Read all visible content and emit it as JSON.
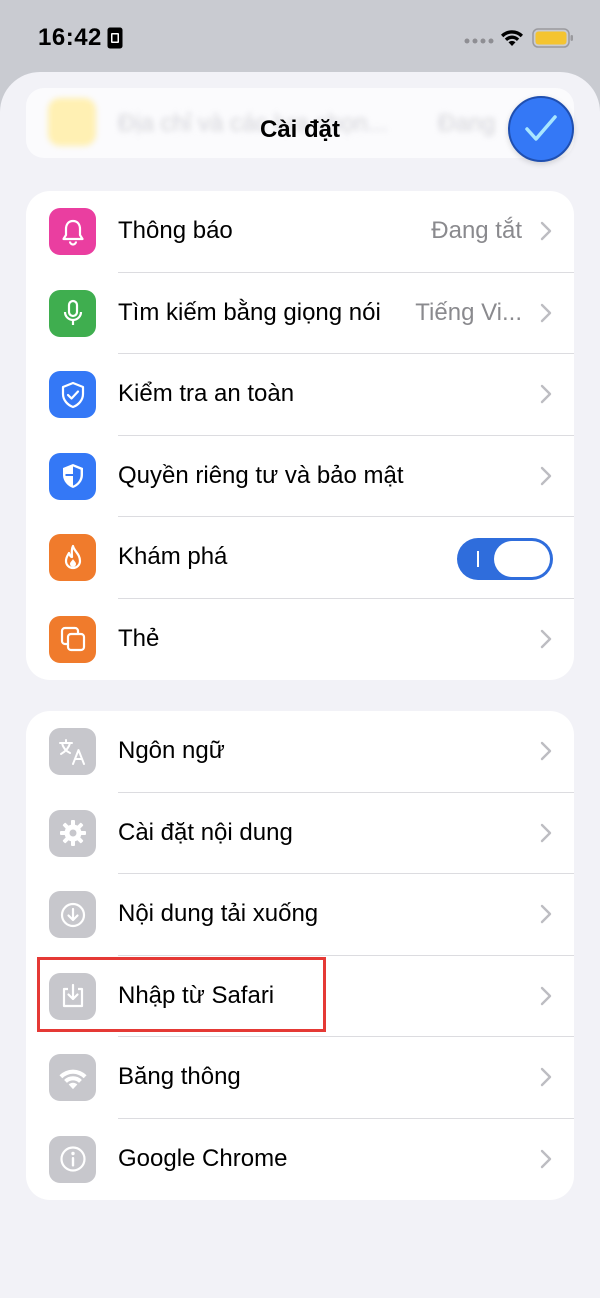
{
  "status_bar": {
    "time": "16:42"
  },
  "sheet": {
    "title": "Cài đặt",
    "background_row": {
      "label": "Địa chỉ và các lựa chọn...",
      "value": "Đang"
    }
  },
  "groups": [
    {
      "rows": [
        {
          "label": "Thông báo",
          "value": "Đang tắt",
          "icon": "bell-icon",
          "color": "#ea3ea0"
        },
        {
          "label": "Tìm kiếm bằng giọng nói",
          "value": "Tiếng Vi...",
          "icon": "microphone-icon",
          "color": "#3fae4f"
        },
        {
          "label": "Kiểm tra an toàn",
          "value": "",
          "icon": "shield-check-icon",
          "color": "#3478f6"
        },
        {
          "label": "Quyền riêng tư và bảo mật",
          "value": "",
          "icon": "shield-icon",
          "color": "#3478f6"
        },
        {
          "label": "Khám phá",
          "value": "",
          "icon": "flame-icon",
          "color": "#f07b2c",
          "toggle_on": true
        },
        {
          "label": "Thẻ",
          "value": "",
          "icon": "tabs-icon",
          "color": "#f07b2c"
        }
      ]
    },
    {
      "rows": [
        {
          "label": "Ngôn ngữ",
          "value": "",
          "icon": "translate-icon",
          "color": "#c7c7cc"
        },
        {
          "label": "Cài đặt nội dung",
          "value": "",
          "icon": "gear-icon",
          "color": "#c7c7cc"
        },
        {
          "label": "Nội dung tải xuống",
          "value": "",
          "icon": "download-circle-icon",
          "color": "#c7c7cc"
        },
        {
          "label": "Nhập từ Safari",
          "value": "",
          "icon": "import-icon",
          "color": "#c7c7cc"
        },
        {
          "label": "Băng thông",
          "value": "",
          "icon": "wifi-icon",
          "color": "#c7c7cc"
        },
        {
          "label": "Google Chrome",
          "value": "",
          "icon": "info-icon",
          "color": "#c7c7cc"
        }
      ]
    }
  ],
  "colors": {
    "accent": "#3478f6",
    "highlight": "#e53935",
    "battery": "#f4c430"
  }
}
